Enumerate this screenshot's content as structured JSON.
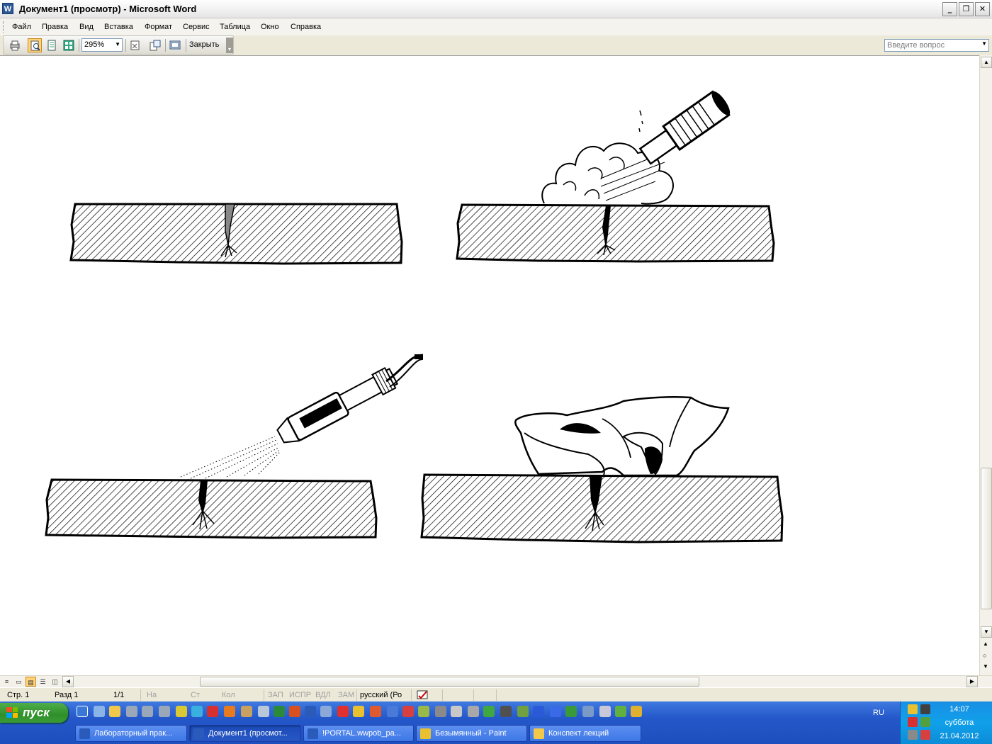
{
  "window": {
    "title": "Документ1 (просмотр) - Microsoft Word",
    "app_icon_letter": "W"
  },
  "menu": {
    "items": [
      "Файл",
      "Правка",
      "Вид",
      "Вставка",
      "Формат",
      "Сервис",
      "Таблица",
      "Окно",
      "Справка"
    ],
    "ask_placeholder": "Введите вопрос"
  },
  "toolbar": {
    "zoom": "295%",
    "close_label": "Закрыть"
  },
  "statusbar": {
    "page": "Стр. 1",
    "section": "Разд 1",
    "pages": "1/1",
    "at": "На",
    "line": "Ст",
    "col": "Кол",
    "rec": "ЗАП",
    "trk": "ИСПР",
    "ext": "ВДЛ",
    "ovr": "ЗАМ",
    "lang": "русский (Ро"
  },
  "taskbar": {
    "start_label": "пуск",
    "tasks": [
      {
        "label": "Лабораторный прак...",
        "active": false
      },
      {
        "label": "Документ1 (просмот...",
        "active": true
      },
      {
        "label": "!PORTAL.wwpob_pa...",
        "active": false
      },
      {
        "label": "Безымянный - Paint",
        "active": false
      },
      {
        "label": "Конспект лекций",
        "active": false
      }
    ],
    "lang": "RU",
    "time": "14:07",
    "day": "суббота",
    "date": "21.04.2012"
  },
  "colors": {
    "taskbar": "#2457c9",
    "start": "#2f8f2b",
    "tray": "#10a0ea",
    "highlight": "#ffd37a"
  }
}
